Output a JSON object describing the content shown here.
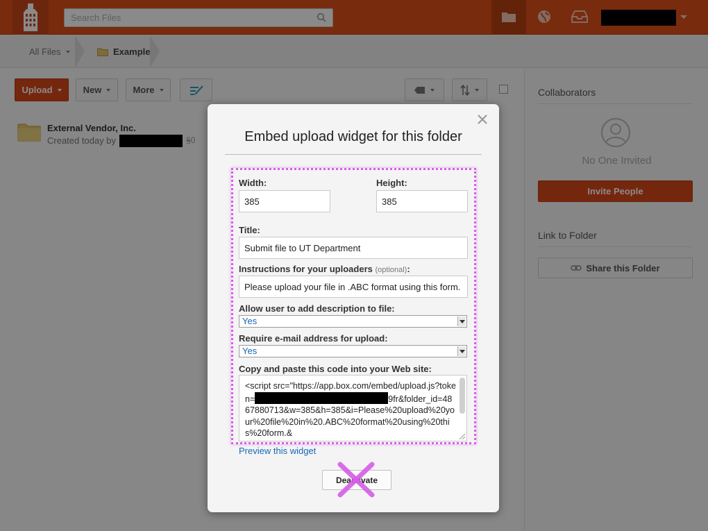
{
  "topbar": {
    "search_placeholder": "Search Files",
    "accent_color": "#e0501b"
  },
  "breadcrumb": {
    "root": "All Files",
    "current": "Example"
  },
  "toolbar": {
    "upload": "Upload",
    "new": "New",
    "more": "More"
  },
  "files": [
    {
      "name": "External Vendor, Inc.",
      "meta": "Created today by",
      "count": "0"
    }
  ],
  "right_panel": {
    "collaborators_heading": "Collaborators",
    "no_one_invited": "No One Invited",
    "invite_button": "Invite People",
    "link_heading": "Link to Folder",
    "share_button": "Share this Folder"
  },
  "modal": {
    "title": "Embed upload widget for this folder",
    "width_label": "Width:",
    "width_value": "385",
    "height_label": "Height:",
    "height_value": "385",
    "title_label": "Title:",
    "title_value": "Submit file to UT Department",
    "instructions_label": "Instructions for your uploaders",
    "instructions_optional": "(optional)",
    "instructions_colon": ":",
    "instructions_value": "Please upload your file in .ABC format using this form.",
    "description_label": "Allow user to add description to file:",
    "description_value": "Yes",
    "email_label": "Require e-mail address for upload:",
    "email_value": "Yes",
    "code_label": "Copy and paste this code into your Web site:",
    "code_before_token": "<script src=\"https://app.box.com/embed/upload.js?token=",
    "code_after_token": "9fr&folder_id=4867880713&w=385&h=385&i=Please%20upload%20your%20file%20in%20.ABC%20format%20using%20this%20form.&",
    "preview_link": "Preview this widget",
    "deactivate_button": "Deactivate",
    "highlight_color": "#d65ee7"
  }
}
